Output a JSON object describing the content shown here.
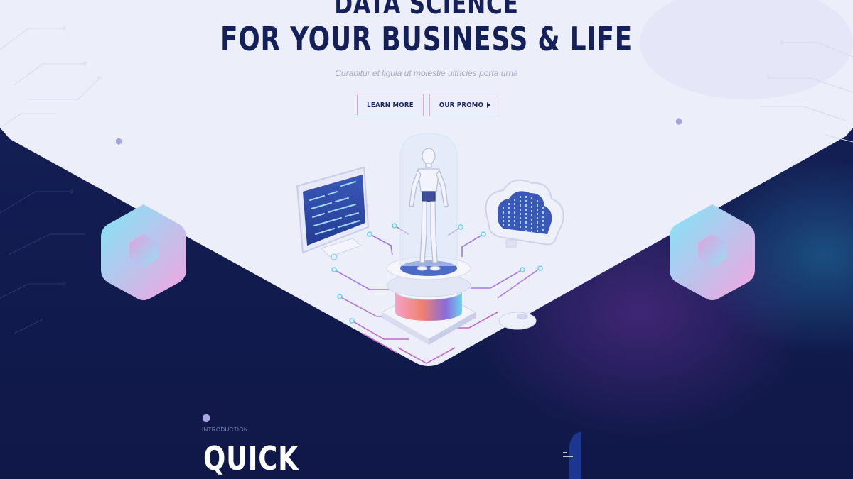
{
  "hero": {
    "title_line1": "DATA SCIENCE",
    "title_line2": "FOR YOUR BUSINESS & LIFE",
    "subtitle": "Curabitur et ligula ut molestie ultricies porta urna",
    "buttons": {
      "learn_more": "LEARN MORE",
      "our_promo": "OUR PROMO"
    }
  },
  "intro_section": {
    "eyebrow": "INTRODUCTION",
    "heading": "QUICK"
  },
  "icons": {
    "play": "play-icon",
    "hexagon": "hexagon-icon",
    "monitor": "monitor-icon",
    "robot": "robot-figure",
    "cloud": "cloud-icon"
  },
  "colors": {
    "hero_bg": "#eceef9",
    "dark_bg": "#121c50",
    "title": "#14205a",
    "button_border": "#e2a6d6",
    "accent_pink": "#f19ad8",
    "accent_cyan": "#6fe0f2"
  }
}
